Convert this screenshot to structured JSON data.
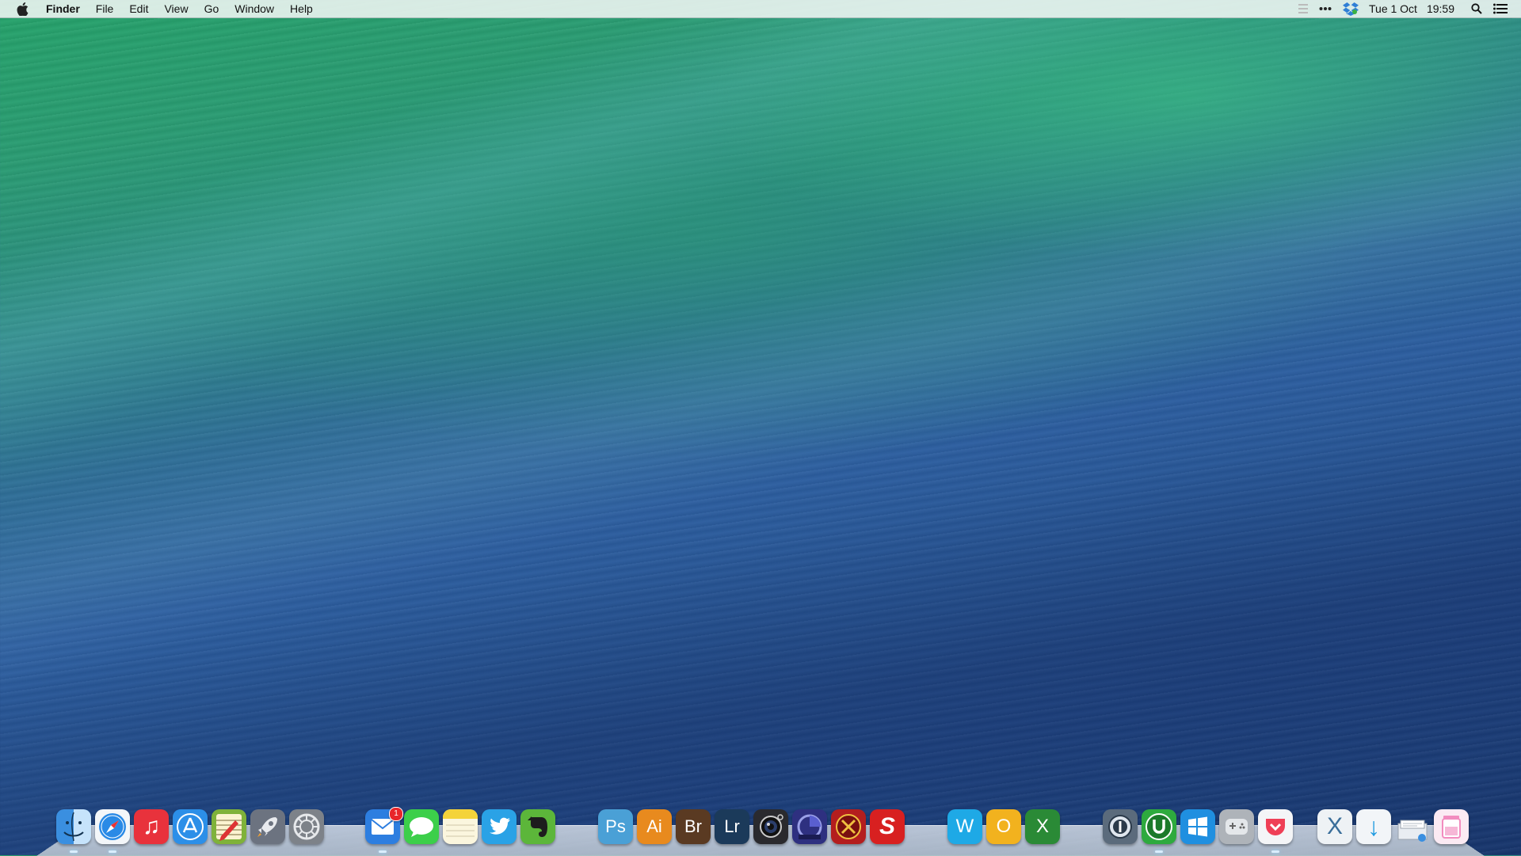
{
  "menubar": {
    "app_name": "Finder",
    "menus": [
      "File",
      "Edit",
      "View",
      "Go",
      "Window",
      "Help"
    ],
    "clock_day": "Tue 1 Oct",
    "clock_time": "19:59",
    "status_icons": [
      "notification-grip-icon",
      "more-dots-icon",
      "dropbox-icon",
      "spotlight-icon",
      "notification-center-icon"
    ]
  },
  "dock": {
    "items": [
      {
        "name": "finder",
        "icon": "finder-icon",
        "label": "",
        "color": "#3a8fe0"
      },
      {
        "name": "safari",
        "icon": "compass-icon",
        "label": "",
        "color": "#2a8ae6"
      },
      {
        "name": "music",
        "icon": "music-note-icon",
        "label": "♫",
        "color": "#e8323c"
      },
      {
        "name": "app-store",
        "icon": "app-store-icon",
        "label": "A",
        "color": "#2c8fe8"
      },
      {
        "name": "sketch-tool",
        "icon": "pencil-tool-icon",
        "label": "✎",
        "color": "#7fb23a"
      },
      {
        "name": "launchpad",
        "icon": "rocket-icon",
        "label": "🚀",
        "color": "#6c7380"
      },
      {
        "name": "system-preferences",
        "icon": "gear-icon",
        "label": "⚙",
        "color": "#7d8289"
      },
      {
        "name": "mail",
        "icon": "mail-icon",
        "label": "✉",
        "color": "#2d7ee0"
      },
      {
        "name": "messages",
        "icon": "chat-bubble-icon",
        "label": "💬",
        "color": "#3ccf4a"
      },
      {
        "name": "notes",
        "icon": "notes-icon",
        "label": "",
        "color": "#f4d33a"
      },
      {
        "name": "twitter",
        "icon": "bird-icon",
        "label": "🐦",
        "color": "#2aa2e6"
      },
      {
        "name": "evernote",
        "icon": "elephant-icon",
        "label": "🐘",
        "color": "#5cb63a"
      },
      {
        "name": "photoshop",
        "icon": "photoshop-icon",
        "label": "Ps",
        "color": "#4aa0d6"
      },
      {
        "name": "illustrator",
        "icon": "illustrator-icon",
        "label": "Ai",
        "color": "#e88a1e"
      },
      {
        "name": "bridge",
        "icon": "bridge-icon",
        "label": "Br",
        "color": "#5a3a22"
      },
      {
        "name": "lightroom",
        "icon": "lightroom-icon",
        "label": "Lr",
        "color": "#1b3a5a"
      },
      {
        "name": "photo-booth",
        "icon": "camera-lens-icon",
        "label": "◉",
        "color": "#2a2a2e"
      },
      {
        "name": "aperture",
        "icon": "aperture-icon",
        "label": "◔",
        "color": "#2e3080"
      },
      {
        "name": "app-red-round",
        "icon": "red-emblem-icon",
        "label": "✪",
        "color": "#b41e1e"
      },
      {
        "name": "stuffit-pro",
        "icon": "s-pro-icon",
        "label": "S",
        "color": "#d82020"
      },
      {
        "name": "word",
        "icon": "word-icon",
        "label": "W",
        "color": "#1ea9e6"
      },
      {
        "name": "outlook",
        "icon": "outlook-icon",
        "label": "O",
        "color": "#f2b21e"
      },
      {
        "name": "excel",
        "icon": "excel-icon",
        "label": "X",
        "color": "#2a8a36"
      },
      {
        "name": "1password",
        "icon": "keyhole-icon",
        "label": "ⓘ",
        "color": "#5b6b7c"
      },
      {
        "name": "upwork",
        "icon": "u-logo-icon",
        "label": "U",
        "color": "#2eaa3e"
      },
      {
        "name": "windows",
        "icon": "windows-logo-icon",
        "label": "⊞",
        "color": "#1f8fe0"
      },
      {
        "name": "game-controller",
        "icon": "gamepad-icon",
        "label": "✣",
        "color": "#aeb3b9"
      },
      {
        "name": "pocket",
        "icon": "pocket-icon",
        "label": "❤",
        "color": "#ef3f56"
      },
      {
        "name": "xcode-like",
        "icon": "x-icon",
        "label": "X",
        "color": "#eef2f5"
      },
      {
        "name": "downloads",
        "icon": "download-arrow-icon",
        "label": "↓",
        "color": "#f2f5f8"
      },
      {
        "name": "documents",
        "icon": "document-stack-icon",
        "label": "",
        "color": "#e9edf2"
      },
      {
        "name": "trash",
        "icon": "trash-icon",
        "label": "",
        "color": "#f6c7de"
      }
    ],
    "mail_badge": "1"
  }
}
